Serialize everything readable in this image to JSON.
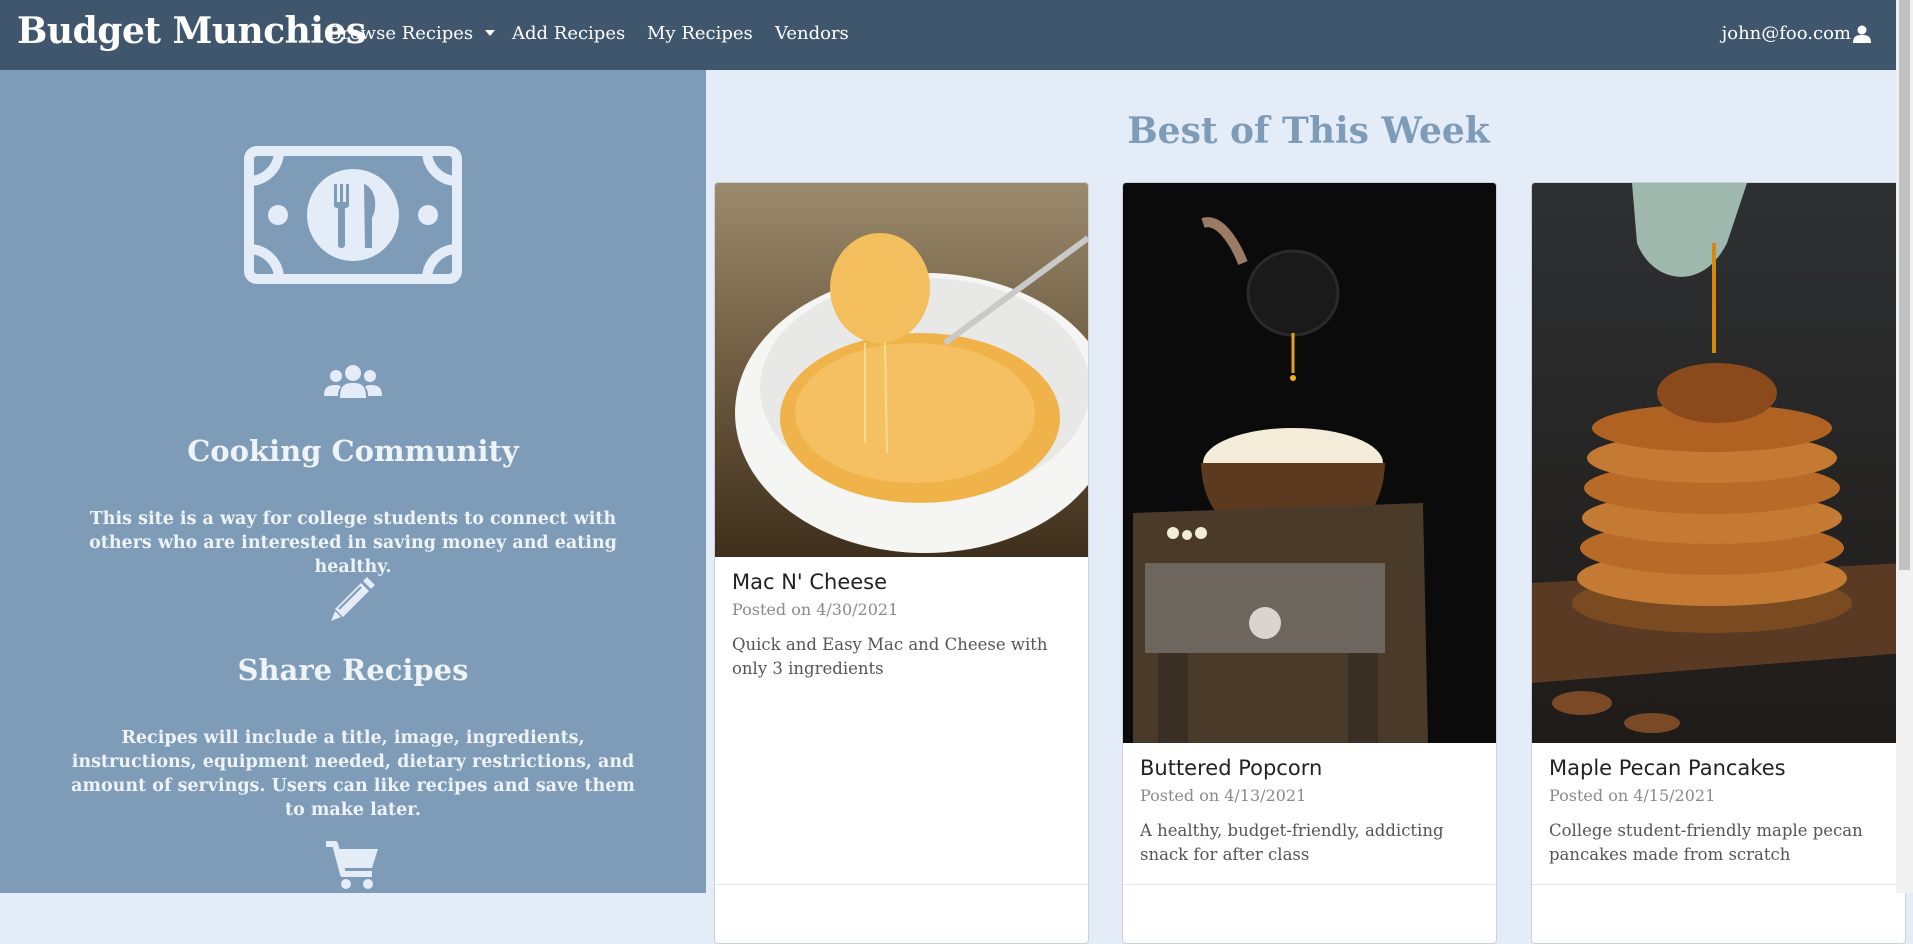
{
  "navbar": {
    "brand": "Budget Munchies",
    "items": [
      {
        "label": "Browse Recipes"
      },
      {
        "label": "Add Recipes"
      },
      {
        "label": "My Recipes"
      },
      {
        "label": "Vendors"
      }
    ],
    "user": "john@foo.com",
    "background": "#40566d"
  },
  "left": {
    "background": "#7e9bb7",
    "features": [
      {
        "icon": "users-icon",
        "title": "Cooking Community",
        "text": "This site is a way for college students to connect with others who are interested in saving money and eating healthy."
      },
      {
        "icon": "pencil-icon",
        "title": "Share Recipes",
        "text": "Recipes will include a title, image, ingredients, instructions, equipment needed, dietary restrictions, and amount of servings. Users can like recipes and save them to make later."
      },
      {
        "icon": "shopping-cart-icon"
      }
    ]
  },
  "main": {
    "title": "Best of This Week",
    "cards": [
      {
        "title": "Mac N' Cheese",
        "date": "Posted on 4/30/2021",
        "description": "Quick and Easy Mac and Cheese with only 3 ingredients",
        "image": "mac-and-cheese-photo"
      },
      {
        "title": "Buttered Popcorn",
        "date": "Posted on 4/13/2021",
        "description": "A healthy, budget-friendly, addicting snack for after class",
        "image": "popcorn-photo"
      },
      {
        "title": "Maple Pecan Pancakes",
        "date": "Posted on 4/15/2021",
        "description": "College student-friendly maple pecan pancakes made from scratch",
        "image": "pancakes-photo"
      }
    ]
  }
}
